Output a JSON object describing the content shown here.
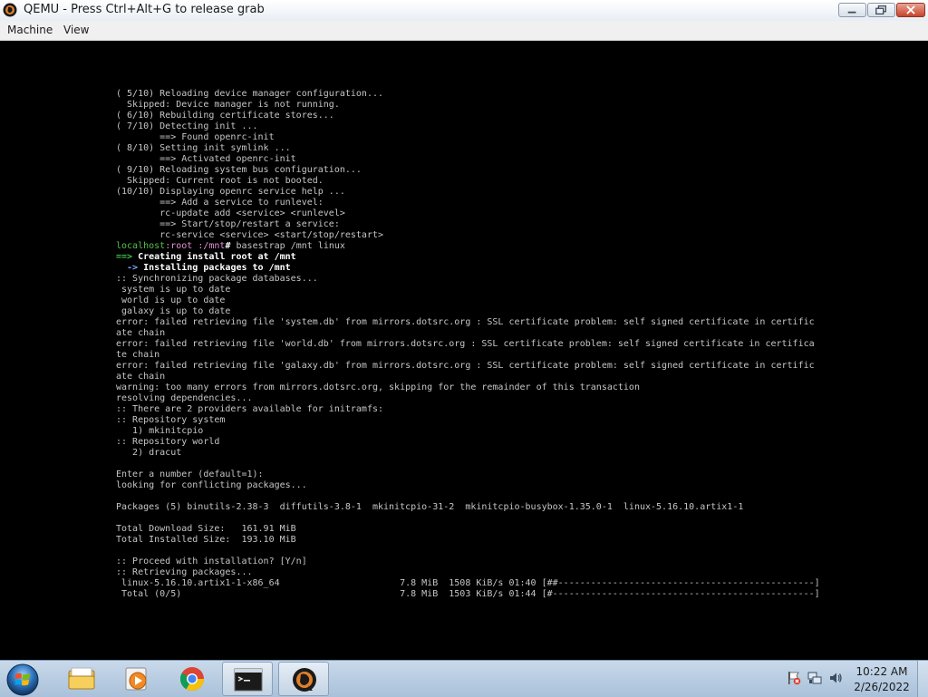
{
  "window": {
    "title": "QEMU - Press Ctrl+Alt+G to release grab",
    "app_icon": "qemu-icon",
    "controls": [
      "minimize-icon",
      "maximize-icon",
      "close-icon"
    ]
  },
  "menu": {
    "machine": "Machine",
    "view": "View"
  },
  "terminal": {
    "lines": [
      {
        "t": "( 5/10) Reloading device manager configuration..."
      },
      {
        "t": "  Skipped: Device manager is not running."
      },
      {
        "t": "( 6/10) Rebuilding certificate stores..."
      },
      {
        "t": "( 7/10) Detecting init ..."
      },
      {
        "t": "        ==> Found openrc-init"
      },
      {
        "t": "( 8/10) Setting init symlink ..."
      },
      {
        "t": "        ==> Activated openrc-init"
      },
      {
        "t": "( 9/10) Reloading system bus configuration..."
      },
      {
        "t": "  Skipped: Current root is not booted."
      },
      {
        "t": "(10/10) Displaying openrc service help ..."
      },
      {
        "t": "        ==> Add a service to runlevel:"
      },
      {
        "t": "        rc-update add <service> <runlevel>"
      },
      {
        "t": "        ==> Start/stop/restart a service:"
      },
      {
        "t": "        rc-service <service> <start/stop/restart>"
      },
      {
        "prompt": {
          "host": "localhost",
          "sep1": ":",
          "user": "root",
          "sep2": " :",
          "path": "/mnt",
          "hash": "#",
          "cmd": " basestrap /mnt linux"
        }
      },
      {
        "arrow": "==>",
        "bt": " Creating install root at /mnt"
      },
      {
        "arrow": "  ->",
        "bt": " Installing packages to /mnt"
      },
      {
        "t": ":: Synchronizing package databases..."
      },
      {
        "t": " system is up to date"
      },
      {
        "t": " world is up to date"
      },
      {
        "t": " galaxy is up to date"
      },
      {
        "t": "error: failed retrieving file 'system.db' from mirrors.dotsrc.org : SSL certificate problem: self signed certificate in certific"
      },
      {
        "t": "ate chain"
      },
      {
        "t": "error: failed retrieving file 'world.db' from mirrors.dotsrc.org : SSL certificate problem: self signed certificate in certifica"
      },
      {
        "t": "te chain"
      },
      {
        "t": "error: failed retrieving file 'galaxy.db' from mirrors.dotsrc.org : SSL certificate problem: self signed certificate in certific"
      },
      {
        "t": "ate chain"
      },
      {
        "t": "warning: too many errors from mirrors.dotsrc.org, skipping for the remainder of this transaction"
      },
      {
        "t": "resolving dependencies..."
      },
      {
        "t": ":: There are 2 providers available for initramfs:"
      },
      {
        "t": ":: Repository system"
      },
      {
        "t": "   1) mkinitcpio"
      },
      {
        "t": ":: Repository world"
      },
      {
        "t": "   2) dracut"
      },
      {
        "t": ""
      },
      {
        "t": "Enter a number (default=1):"
      },
      {
        "t": "looking for conflicting packages..."
      },
      {
        "t": ""
      },
      {
        "t": "Packages (5) binutils-2.38-3  diffutils-3.8-1  mkinitcpio-31-2  mkinitcpio-busybox-1.35.0-1  linux-5.16.10.artix1-1"
      },
      {
        "t": ""
      },
      {
        "t": "Total Download Size:   161.91 MiB"
      },
      {
        "t": "Total Installed Size:  193.10 MiB"
      },
      {
        "t": ""
      },
      {
        "t": ":: Proceed with installation? [Y/n]"
      },
      {
        "t": ":: Retrieving packages..."
      },
      {
        "t": " linux-5.16.10.artix1-1-x86_64                      7.8 MiB  1508 KiB/s 01:40 [##-----------------------------------------------]   5%"
      },
      {
        "t": " Total (0/5)                                        7.8 MiB  1503 KiB/s 01:44 [#------------------------------------------------]   4%"
      }
    ]
  },
  "taskbar": {
    "start": "windows-start-orb-icon",
    "pinned": [
      {
        "name": "explorer-folder-icon"
      },
      {
        "name": "media-player-icon"
      },
      {
        "name": "chrome-icon"
      },
      {
        "name": "command-prompt-icon"
      },
      {
        "name": "qemu-icon"
      }
    ],
    "tray": {
      "icons": [
        "action-center-flag-icon",
        "network-icon",
        "volume-icon"
      ],
      "time": "10:22 AM",
      "date": "2/26/2022"
    }
  },
  "colors": {
    "terminal_bg": "#000000",
    "terminal_fg": "#c6c6c6",
    "prompt_host": "#54c24e",
    "prompt_user": "#e88fd3",
    "arrow_green": "#3ac34b",
    "arrow_blue": "#7aa7ff"
  }
}
